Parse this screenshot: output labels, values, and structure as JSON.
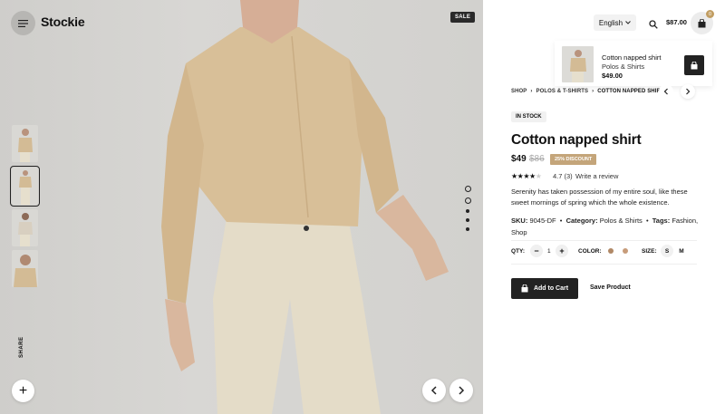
{
  "header": {
    "logo": "Stockie",
    "language": "English",
    "cart_total": "$87.00",
    "cart_count": "0",
    "sale_badge": "SALE"
  },
  "gallery": {
    "share_label": "SHARE",
    "thumbnails": [
      "thumb-1",
      "thumb-2",
      "thumb-3",
      "thumb-4"
    ],
    "active_thumbnail": 2
  },
  "mini_cart": {
    "title": "Cotton napped shirt",
    "subtitle": "Polos & Shirts",
    "price": "$49.00"
  },
  "breadcrumb": {
    "items": [
      "SHOP",
      "POLOS & T-SHIRTS",
      "COTTON NAPPED SHIRT"
    ],
    "separator": "›"
  },
  "product": {
    "stock": "IN STOCK",
    "title": "Cotton napped shirt",
    "price": "$49",
    "old_price": "$86",
    "discount": "25% DISCOUNT",
    "stars": "★★★★",
    "star_empty": "★",
    "rating": "4.7 (3)",
    "review_link": "Write a review",
    "description": "Serenity has taken possession of my entire soul, like these sweet mornings of spring which the whole existence.",
    "sku_label": "SKU:",
    "sku": "9045-DF",
    "category_label": "Category:",
    "category": "Polos & Shirts",
    "tags_label": "Tags:",
    "tags": "Fashion, Shop",
    "qty_label": "QTY:",
    "qty": "1",
    "color_label": "COLOR:",
    "colors": [
      "#b08866",
      "#c79c7a"
    ],
    "size_label": "SIZE:",
    "sizes": [
      "S",
      "M"
    ],
    "add_to_cart": "Add to Cart",
    "save": "Save Product"
  },
  "colors": {
    "accent": "#c4a57a",
    "badge": "#c29e63",
    "dark": "#222222"
  }
}
